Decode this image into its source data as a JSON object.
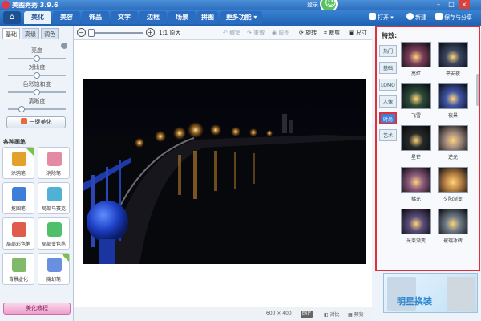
{
  "app": {
    "title": "美图秀秀 3.9.6",
    "login": "登录"
  },
  "menu": {
    "tabs": [
      "美化",
      "美容",
      "饰品",
      "文字",
      "边框",
      "场景",
      "拼图"
    ],
    "more": "更多功能",
    "open": "打开",
    "new": "新建",
    "save_share": "保存与分享"
  },
  "left": {
    "sub_tabs": [
      "基础",
      "高级",
      "调色"
    ],
    "sliders": [
      {
        "label": "亮度",
        "value": 0.5
      },
      {
        "label": "对比度",
        "value": 0.5
      },
      {
        "label": "色彩饱和度",
        "value": 0.5
      },
      {
        "label": "清晰度",
        "value": 0.2
      }
    ],
    "one_key_label": "一键美化",
    "brush_title": "各种画笔",
    "brushes": [
      {
        "label": "涂鸦笔",
        "icon": "pen-icon",
        "color": "#e3a02a",
        "is_new": true
      },
      {
        "label": "消除笔",
        "icon": "eraser-icon",
        "color": "#e58aa5",
        "is_new": false
      },
      {
        "label": "抠图笔",
        "icon": "cutout-icon",
        "color": "#3d7fd8",
        "is_new": false
      },
      {
        "label": "局部马赛克",
        "icon": "mosaic-icon",
        "color": "#4fb1d6",
        "is_new": false
      },
      {
        "label": "局部彩色笔",
        "icon": "color-pen-icon",
        "color": "#e05a4e",
        "is_new": false
      },
      {
        "label": "局部变色笔",
        "icon": "recolor-icon",
        "color": "#4fc06a",
        "is_new": false
      },
      {
        "label": "背景虚化",
        "icon": "blur-icon",
        "color": "#7fb96a",
        "is_new": false
      },
      {
        "label": "魔幻笔",
        "icon": "magic-icon",
        "color": "#6b8fe0",
        "is_new": true
      }
    ],
    "tutorial_label": "美化教程"
  },
  "toolbar": {
    "original_size": "1:1 原大",
    "undo": "撤销",
    "redo": "重做",
    "restore": "原图",
    "rotate": "旋转",
    "crop": "裁剪",
    "resize": "尺寸"
  },
  "status": {
    "dimensions": "600 × 400",
    "exif": "EXIF",
    "compare": "对比",
    "preview": "预览"
  },
  "effects": {
    "title": "特效",
    "categories": [
      "热门",
      "基础",
      "LOMO",
      "人像",
      "时尚",
      "艺术"
    ],
    "active_category": "时尚",
    "items": [
      {
        "label": "亮红",
        "tone": "#7a3f5a"
      },
      {
        "label": "平安夜",
        "tone": "#3a4660"
      },
      {
        "label": "飞雪",
        "tone": "#2d4b3a"
      },
      {
        "label": "夜景",
        "tone": "#3e56a8"
      },
      {
        "label": "星芒",
        "tone": "#242a28"
      },
      {
        "label": "逆光",
        "tone": "#a78f80"
      },
      {
        "label": "拂光",
        "tone": "#8e5d7e"
      },
      {
        "label": "夕阳渐变",
        "tone": "#c28a4a"
      },
      {
        "label": "光束渐变",
        "tone": "#5a4e78"
      },
      {
        "label": "玻璃冰砖",
        "tone": "#6f7c88"
      }
    ]
  },
  "ad": {
    "text": "明星换装"
  }
}
